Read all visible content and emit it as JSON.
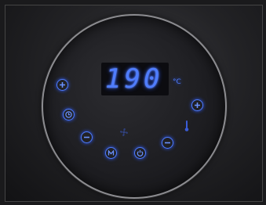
{
  "display": {
    "temperature": "190",
    "unit": "°C"
  },
  "colors": {
    "accent": "#4f7dff",
    "glow": "#2f5cff",
    "bezel": "#8c8c90",
    "panel": "#1e1e22"
  },
  "controls": {
    "left_plus": "plus-icon",
    "timer": "clock-icon",
    "left_minus": "minus-icon",
    "mode": "m-icon",
    "power": "power-icon",
    "right_minus": "minus-icon",
    "right_plus": "plus-icon",
    "fan": "fan-icon",
    "thermometer": "thermometer-icon"
  }
}
